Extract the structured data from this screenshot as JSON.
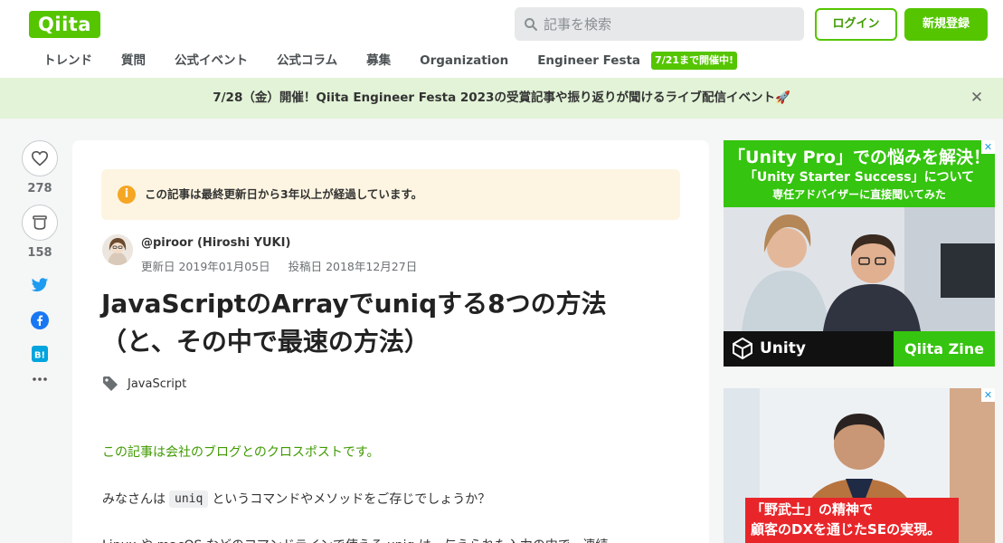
{
  "header": {
    "logo": "Qiita",
    "search_placeholder": "記事を検索",
    "login": "ログイン",
    "signup": "新規登録"
  },
  "nav": {
    "items": [
      "トレンド",
      "質問",
      "公式イベント",
      "公式コラム",
      "募集",
      "Organization",
      "Engineer Festa"
    ],
    "badge": "7/21まで開催中!"
  },
  "banner": {
    "text": "7/28（金）開催！Qiita Engineer Festa 2023の受賞記事や振り返りが聞けるライブ配信イベント🚀"
  },
  "actions": {
    "likes": "278",
    "stocks": "158"
  },
  "article": {
    "notice": "この記事は最終更新日から3年以上が経過しています。",
    "author": "@piroor (Hiroshi YUKI)",
    "updated": "更新日 2019年01月05日",
    "posted": "投稿日 2018年12月27日",
    "title_line1": "JavaScriptのArrayでuniqする8つの方法",
    "title_line2": "（と、その中で最速の方法）",
    "tag": "JavaScript",
    "p1": "この記事は会社のブログとのクロスポストです。",
    "p2_before": "みなさんは",
    "p2_code": "uniq",
    "p2_after": "というコマンドやメソッドをご存じでしょうか？",
    "p3": "Linux や macOS などのコマンドラインで使える uniq は、与えられた入力の中で、連続..."
  },
  "ads": {
    "ad1": {
      "headline": "「Unity Pro」での悩みを解決！",
      "sub1": "「Unity Starter Success」について",
      "sub2": "専任アドバイザーに直接聞いてみた",
      "brand_left": "Unity",
      "brand_right": "Qiita Zine"
    },
    "ad2": {
      "line1": "「野武士」の精神で",
      "line2": "顧客のDXを通じたSEの実現。"
    }
  },
  "colors": {
    "brand": "#55c500",
    "banner_bg": "#e2f3d7",
    "notice_bg": "#fdf5e1",
    "link_green": "#3f9a00"
  }
}
